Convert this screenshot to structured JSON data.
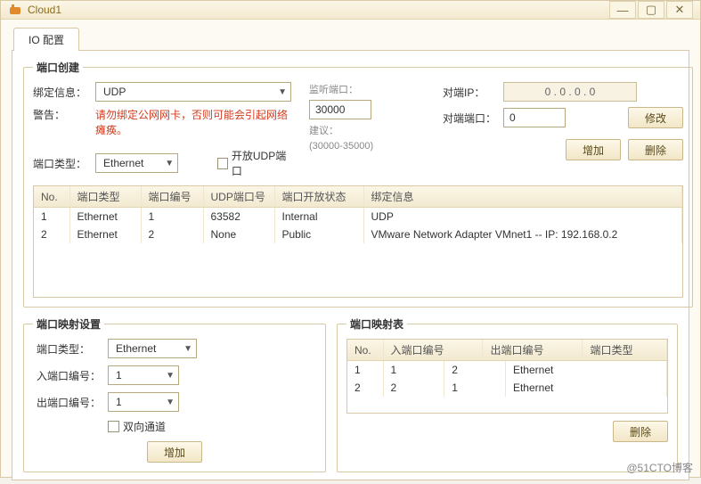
{
  "window": {
    "title": "Cloud1",
    "min_icon": "—",
    "max_icon": "▢",
    "close_icon": "✕"
  },
  "tab": {
    "label": "IO 配置"
  },
  "port_create": {
    "legend": "端口创建",
    "bind_label": "绑定信息：",
    "bind_value": "UDP",
    "warn_label": "警告：",
    "warn_text": "请勿绑定公网网卡，否则可能会引起网络瘫痪。",
    "type_label": "端口类型：",
    "type_value": "Ethernet",
    "open_udp_label": "开放UDP端口",
    "listen_label": "监听端口：",
    "listen_value": "30000",
    "suggest_label": "建议：",
    "suggest_range": "(30000-35000)",
    "peer_ip_label": "对端IP：",
    "peer_ip_value": "0   .   0   .   0   .   0",
    "peer_port_label": "对端端口：",
    "peer_port_value": "0",
    "modify_btn": "修改",
    "add_btn": "增加",
    "delete_btn": "删除",
    "table": {
      "headers": [
        "No.",
        "端口类型",
        "端口编号",
        "UDP端口号",
        "端口开放状态",
        "绑定信息"
      ],
      "rows": [
        [
          "1",
          "Ethernet",
          "1",
          "63582",
          "Internal",
          "UDP"
        ],
        [
          "2",
          "Ethernet",
          "2",
          "None",
          "Public",
          "VMware Network Adapter VMnet1 -- IP: 192.168.0.2"
        ]
      ]
    }
  },
  "map_settings": {
    "legend": "端口映射设置",
    "type_label": "端口类型：",
    "type_value": "Ethernet",
    "in_label": "入端口编号：",
    "in_value": "1",
    "out_label": "出端口编号：",
    "out_value": "1",
    "bidir_label": "双向通道",
    "add_btn": "增加"
  },
  "map_table": {
    "legend": "端口映射表",
    "headers": [
      "No.",
      "入端口编号",
      "出端口编号",
      "端口类型"
    ],
    "rows": [
      [
        "1",
        "1",
        "2",
        "Ethernet"
      ],
      [
        "2",
        "2",
        "1",
        "Ethernet"
      ]
    ],
    "delete_btn": "删除"
  },
  "watermark": "@51CTO博客"
}
